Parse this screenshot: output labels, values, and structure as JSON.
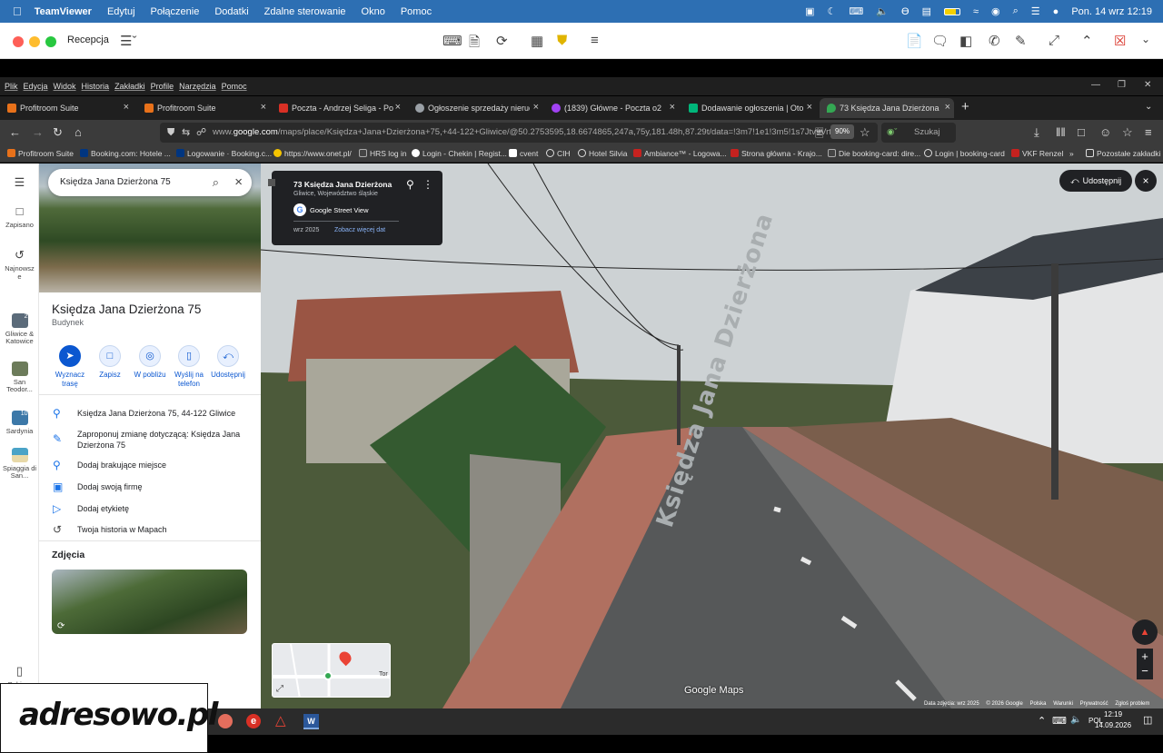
{
  "macos_menubar": {
    "app": "TeamViewer",
    "menus": [
      "Edytuj",
      "Połączenie",
      "Dodatki",
      "Zdalne sterowanie",
      "Okno",
      "Pomoc"
    ],
    "clock": "Pon. 14 wrz  12:19"
  },
  "teamviewer": {
    "session_name": "Recepcja"
  },
  "browser_menu": [
    "Plik",
    "Edycja",
    "Widok",
    "Historia",
    "Zakładki",
    "Profile",
    "Narzędzia",
    "Pomoc"
  ],
  "tabs": [
    {
      "title": "Profitroom Suite",
      "color": "#e8711a",
      "active": false
    },
    {
      "title": "Profitroom Suite",
      "color": "#e8711a",
      "active": false
    },
    {
      "title": "Poczta - Andrzej Seliga - Poczta",
      "color": "#d93025",
      "active": false
    },
    {
      "title": "Ogłoszenie sprzedaży nieruchomo",
      "color": "#9aa0a6",
      "active": false
    },
    {
      "title": "(1839) Główne - Poczta o2",
      "color": "#a142f4",
      "active": false
    },
    {
      "title": "Dodawanie ogłoszenia | Otodom",
      "color": "#00b67a",
      "active": false
    },
    {
      "title": "73 Księdza Jana Dzierżona – Map",
      "color": "#34a853",
      "active": true
    }
  ],
  "address_bar": {
    "prefix": "www.",
    "domain": "google.com",
    "path": "/maps/place/Księdza+Jana+Dzierżona+75,+44-122+Gliwice/@50.2753595,18.6674865,247a,75y,181.48h,87.29t/data=!3m7!1e1!3m5!1s7Jtv9Vrtd",
    "zoom": "90%",
    "search_placeholder": "Szukaj"
  },
  "bookmarks": [
    {
      "label": "Profitroom Suite",
      "color": "#e8711a"
    },
    {
      "label": "Booking.com: Hotele ...",
      "color": "#003580"
    },
    {
      "label": "Logowanie · Booking.c...",
      "color": "#003580"
    },
    {
      "label": "https://www.onet.pl/",
      "color": "#f5c400"
    },
    {
      "label": "HRS log in",
      "color": "#444444"
    },
    {
      "label": "Login - Chekin | Regist...",
      "color": "#ffffff"
    },
    {
      "label": "cvent",
      "color": "#ffffff"
    },
    {
      "label": "CIH",
      "color": "#ffffff"
    },
    {
      "label": "Hotel Silvia",
      "color": "#ffffff"
    },
    {
      "label": "Ambiance™ - Logowa...",
      "color": "#c5221f"
    },
    {
      "label": "Strona główna - Krajo...",
      "color": "#c5221f"
    },
    {
      "label": "Die booking-card: dire...",
      "color": "#444444"
    },
    {
      "label": "Login | booking-card",
      "color": "#ffffff"
    },
    {
      "label": "VKF Renzel",
      "color": "#c5221f"
    }
  ],
  "bookmarks_other": "Pozostałe zakładki",
  "rail": {
    "saved": "Zapisano",
    "recent": "Najnowsze",
    "recent_places": [
      {
        "label": "Gliwice & Katowice",
        "badge": "2",
        "color": "#5b6b7a"
      },
      {
        "label": "San Teodor...",
        "badge": "",
        "color": "#6c7b5a"
      },
      {
        "label": "Sardynia",
        "badge": "10",
        "color": "#3c78a8"
      },
      {
        "label": "Spiaggia di San...",
        "badge": "",
        "color": "#4aa3c7"
      }
    ],
    "bottom": "Pobierz"
  },
  "place_panel": {
    "search_value": "Księdza Jana Dzierżona 75",
    "title": "Księdza Jana Dzierżona 75",
    "category": "Budynek",
    "actions": [
      {
        "label": "Wyznacz trasę",
        "icon": "directions-icon"
      },
      {
        "label": "Zapisz",
        "icon": "bookmark-icon"
      },
      {
        "label": "W pobliżu",
        "icon": "nearby-icon"
      },
      {
        "label": "Wyślij na telefon",
        "icon": "phone-icon"
      },
      {
        "label": "Udostępnij",
        "icon": "share-icon"
      }
    ],
    "address": "Księdza Jana Dzierżona 75, 44-122 Gliwice",
    "suggest_edit": "Zaproponuj zmianę dotyczącą: Księdza Jana Dzierżona 75",
    "add_missing": "Dodaj brakujące miejsce",
    "add_business": "Dodaj swoją firmę",
    "add_label": "Dodaj etykietę",
    "history": "Twoja historia w Mapach",
    "photos_heading": "Zdjęcia"
  },
  "street_view": {
    "card_title": "73 Księdza Jana Dzierżona",
    "card_subtitle": "Gliwice, Województwo śląskie",
    "provider": "Google Street View",
    "date": "wrz 2025",
    "more_dates": "Zobacz więcej dat",
    "share_label": "Udostępnij",
    "road_text": "Księdza Jana Dzierżona",
    "watermark": "Google Maps",
    "minimap_label": "Tor",
    "footer": [
      "Data zdjęcia: wrz 2025",
      "© 2026 Google",
      "Polska",
      "Warunki",
      "Prywatność",
      "Zgłoś problem"
    ]
  },
  "taskbar": {
    "lang": "POL",
    "time": "12:19",
    "date": "14.09.2026"
  },
  "logo_text": "adresowo.pl"
}
